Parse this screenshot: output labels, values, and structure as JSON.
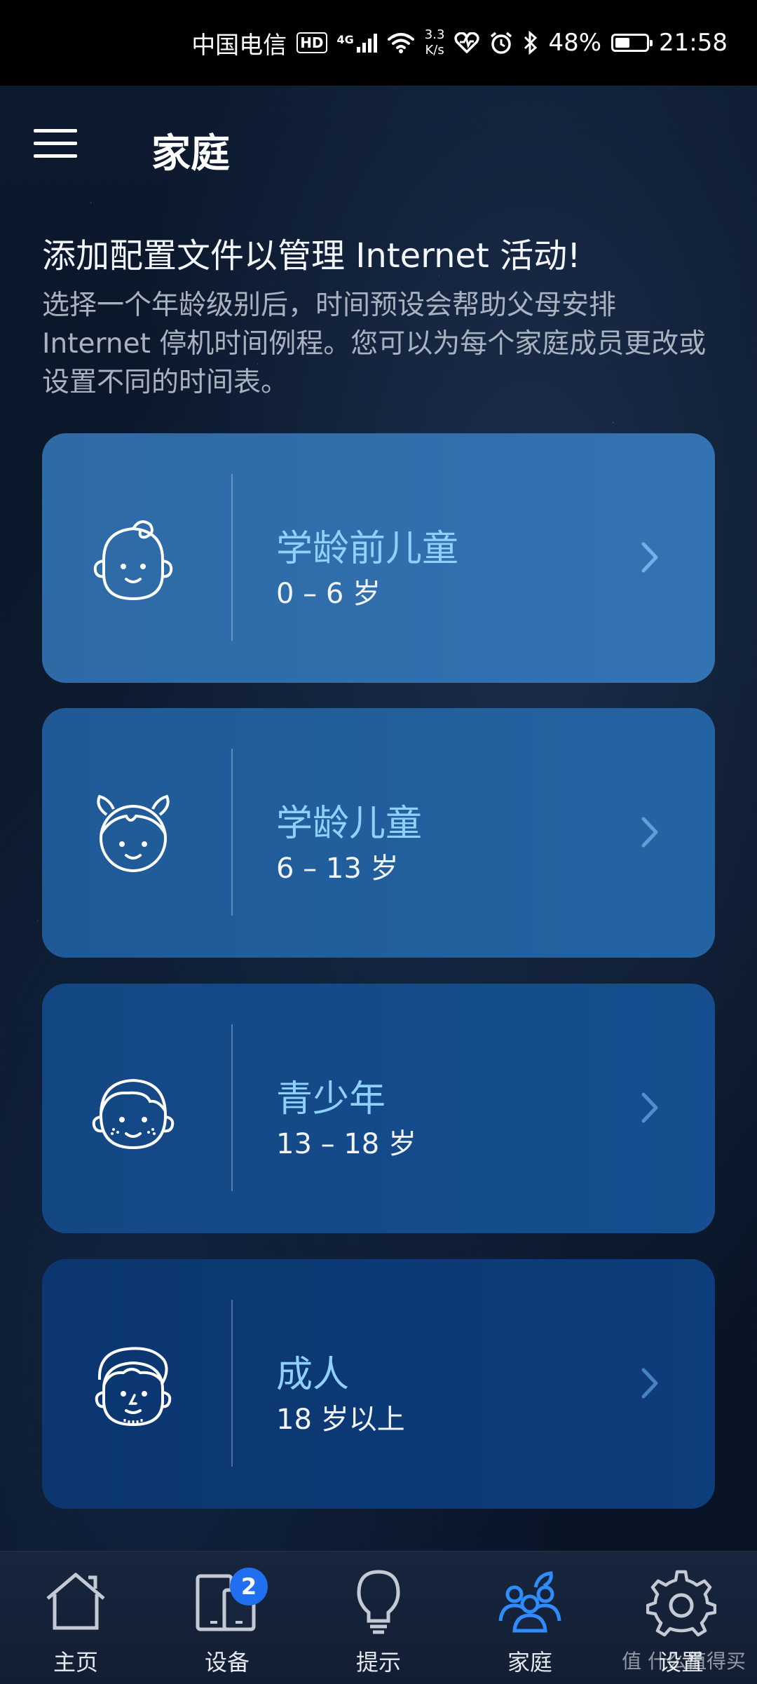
{
  "status_bar": {
    "carrier": "中国电信",
    "hd": "HD",
    "network": "4G",
    "speed_value": "3.3",
    "speed_unit": "K/s",
    "battery": "48%",
    "battery_level": 0.48,
    "time": "21:58"
  },
  "header": {
    "title": "家庭"
  },
  "intro": {
    "title": "添加配置文件以管理 Internet 活动!",
    "description": "选择一个年龄级别后，时间预设会帮助父母安排 Internet 停机时间例程。您可以为每个家庭成员更改或设置不同的时间表。"
  },
  "profiles": [
    {
      "name": "学龄前儿童",
      "range": "0 – 6 岁"
    },
    {
      "name": "学龄儿童",
      "range": "6 – 13 岁"
    },
    {
      "name": "青少年",
      "range": "13 – 18 岁"
    },
    {
      "name": "成人",
      "range": "18 岁以上"
    }
  ],
  "bottom_nav": {
    "tabs": [
      {
        "label": "主页",
        "icon": "home-icon"
      },
      {
        "label": "设备",
        "icon": "devices-icon",
        "badge": "2"
      },
      {
        "label": "提示",
        "icon": "lightbulb-icon"
      },
      {
        "label": "家庭",
        "icon": "family-icon",
        "active": true
      },
      {
        "label": "设置",
        "icon": "gear-icon"
      }
    ]
  },
  "watermark": "值 什么值得买",
  "colors": {
    "accent_blue": "#8fd0ff",
    "active_tab": "#2f8cff",
    "badge": "#1f6ff0"
  }
}
